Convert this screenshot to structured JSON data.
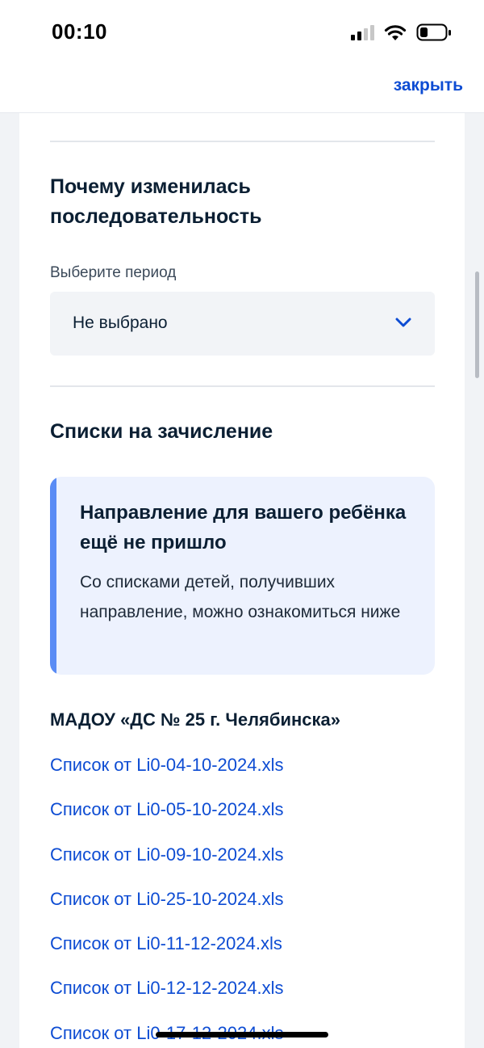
{
  "status_bar": {
    "time": "00:10",
    "icons": [
      "signal-icon",
      "wifi-icon",
      "battery-icon"
    ]
  },
  "header": {
    "close_label": "закрыть"
  },
  "sequence_section": {
    "title": "Почему изменилась последовательность",
    "period_label": "Выберите период",
    "period_value": "Не выбрано"
  },
  "enrollment_section": {
    "title": "Списки на зачисление",
    "notice": {
      "title": "Направление для вашего ребёнка ещё не пришло",
      "text": "Со списками детей, получивших направление, можно ознакомиться ниже"
    },
    "organization": "МАДОУ «ДС № 25 г. Челябинска»",
    "files": [
      "Список от Li0-04-10-2024.xls",
      "Список от Li0-05-10-2024.xls",
      "Список от Li0-09-10-2024.xls",
      "Список от Li0-25-10-2024.xls",
      "Список от Li0-11-12-2024.xls",
      "Список от Li0-12-12-2024.xls",
      "Список от Li0-17-12-2024.xls"
    ]
  },
  "colors": {
    "link": "#0d4cd3",
    "notice_background": "#edf2fe",
    "notice_accent": "#5a8cf5",
    "page_background": "#f1f3f6"
  }
}
